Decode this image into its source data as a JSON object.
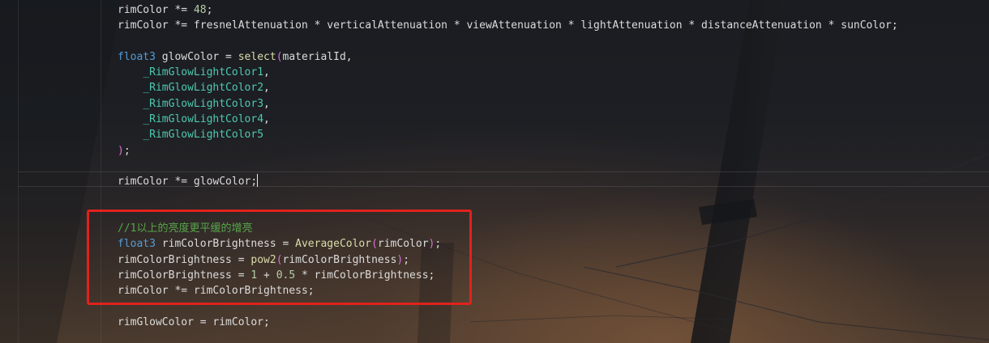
{
  "editor": {
    "code_lines": [
      [
        {
          "t": "rimColor *= ",
          "c": "plain"
        },
        {
          "t": "48",
          "c": "number"
        },
        {
          "t": ";",
          "c": "plain"
        }
      ],
      [
        {
          "t": "rimColor *= fresnelAttenuation * verticalAttenuation * viewAttenuation * lightAttenuation * distanceAttenuation * sunColor;",
          "c": "plain"
        }
      ],
      [],
      [
        {
          "t": "float3",
          "c": "keyword"
        },
        {
          "t": " glowColor = ",
          "c": "plain"
        },
        {
          "t": "select",
          "c": "func"
        },
        {
          "t": "(",
          "c": "paren"
        },
        {
          "t": "materialId,",
          "c": "plain"
        }
      ],
      [
        {
          "t": "    ",
          "c": "plain"
        },
        {
          "t": "_RimGlowLightColor1",
          "c": "param"
        },
        {
          "t": ",",
          "c": "plain"
        }
      ],
      [
        {
          "t": "    ",
          "c": "plain"
        },
        {
          "t": "_RimGlowLightColor2",
          "c": "param"
        },
        {
          "t": ",",
          "c": "plain"
        }
      ],
      [
        {
          "t": "    ",
          "c": "plain"
        },
        {
          "t": "_RimGlowLightColor3",
          "c": "param"
        },
        {
          "t": ",",
          "c": "plain"
        }
      ],
      [
        {
          "t": "    ",
          "c": "plain"
        },
        {
          "t": "_RimGlowLightColor4",
          "c": "param"
        },
        {
          "t": ",",
          "c": "plain"
        }
      ],
      [
        {
          "t": "    ",
          "c": "plain"
        },
        {
          "t": "_RimGlowLightColor5",
          "c": "param"
        }
      ],
      [
        {
          "t": ")",
          "c": "paren"
        },
        {
          "t": ";",
          "c": "plain"
        }
      ],
      [],
      [
        {
          "t": "rimColor *= glowColor;",
          "c": "plain"
        },
        {
          "caret": true
        }
      ],
      [],
      [],
      [
        {
          "t": "//1以上的亮度更平缓的增亮",
          "c": "comment"
        }
      ],
      [
        {
          "t": "float3",
          "c": "keyword"
        },
        {
          "t": " rimColorBrightness = ",
          "c": "plain"
        },
        {
          "t": "AverageColor",
          "c": "func"
        },
        {
          "t": "(",
          "c": "paren"
        },
        {
          "t": "rimColor",
          "c": "plain"
        },
        {
          "t": ")",
          "c": "paren"
        },
        {
          "t": ";",
          "c": "plain"
        }
      ],
      [
        {
          "t": "rimColorBrightness = ",
          "c": "plain"
        },
        {
          "t": "pow2",
          "c": "func"
        },
        {
          "t": "(",
          "c": "paren"
        },
        {
          "t": "rimColorBrightness",
          "c": "plain"
        },
        {
          "t": ")",
          "c": "paren"
        },
        {
          "t": ";",
          "c": "plain"
        }
      ],
      [
        {
          "t": "rimColorBrightness = ",
          "c": "plain"
        },
        {
          "t": "1",
          "c": "number"
        },
        {
          "t": " + ",
          "c": "plain"
        },
        {
          "t": "0.5",
          "c": "number"
        },
        {
          "t": " * rimColorBrightness;",
          "c": "plain"
        }
      ],
      [
        {
          "t": "rimColor *= rimColorBrightness;",
          "c": "plain"
        }
      ],
      [],
      [
        {
          "t": "rimGlowColor = rimColor;",
          "c": "plain"
        }
      ]
    ],
    "highlight_color": "#e0221c"
  }
}
